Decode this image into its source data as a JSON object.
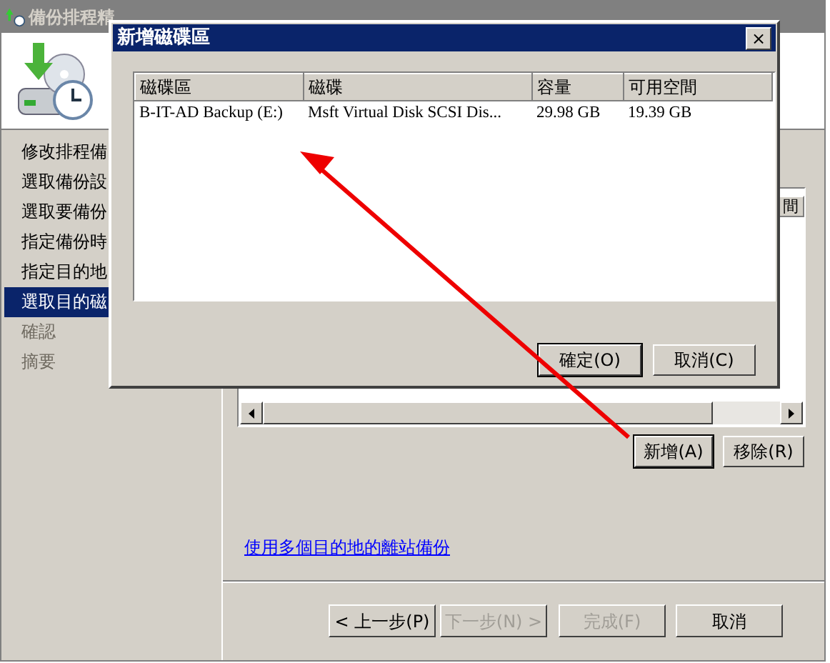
{
  "wizard": {
    "title": "備份排程精",
    "steps": [
      {
        "label": "修改排程備",
        "selected": false,
        "disabled": false
      },
      {
        "label": "選取備份設",
        "selected": false,
        "disabled": false
      },
      {
        "label": "選取要備份",
        "selected": false,
        "disabled": false
      },
      {
        "label": "指定備份時",
        "selected": false,
        "disabled": false
      },
      {
        "label": "指定目的地",
        "selected": false,
        "disabled": false
      },
      {
        "label": "選取目的磁",
        "selected": true,
        "disabled": false
      },
      {
        "label": "確認",
        "selected": false,
        "disabled": true
      },
      {
        "label": "摘要",
        "selected": false,
        "disabled": true
      }
    ],
    "list_header": "間",
    "list_buttons": [
      {
        "label": "新增(A)",
        "focused": true
      },
      {
        "label": "移除(R)",
        "focused": false
      }
    ],
    "link": "使用多個目的地的離站備份",
    "nav_buttons": [
      {
        "label": "< 上一步(P)",
        "disabled": false
      },
      {
        "label": "下一步(N) >",
        "disabled": true
      },
      {
        "label": "完成(F)",
        "disabled": true
      },
      {
        "label": "取消",
        "disabled": false
      }
    ]
  },
  "dialog": {
    "title": "新增磁碟區",
    "close": "×",
    "columns": [
      "磁碟區",
      "磁碟",
      "容量",
      "可用空間"
    ],
    "rows": [
      [
        "B-IT-AD Backup (E:)",
        "Msft Virtual Disk SCSI Dis...",
        "29.98 GB",
        "19.39 GB"
      ]
    ],
    "buttons": [
      {
        "label": "確定(O)",
        "focused": true
      },
      {
        "label": "取消(C)",
        "focused": false
      }
    ]
  }
}
